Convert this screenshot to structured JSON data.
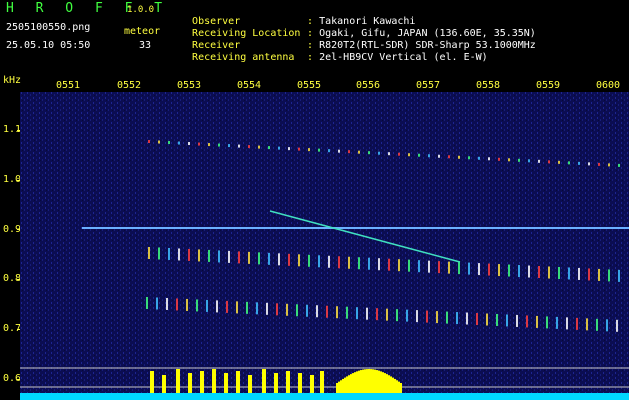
{
  "header": {
    "app_name": "H R O F F T",
    "version": "1.0.0",
    "filename": "2505100550.png",
    "meteor_label": "meteor",
    "datetime": "25.05.10 05:50",
    "meteor_count": "33"
  },
  "info": [
    {
      "label": "Observer",
      "value": "Takanori Kawachi"
    },
    {
      "label": "Receiving Location",
      "value": "Ogaki, Gifu, JAPAN (136.60E, 35.35N)"
    },
    {
      "label": "Receiver",
      "value": "R820T2(RTL-SDR) SDR-Sharp 53.1000MHz"
    },
    {
      "label": "Receiving antenna",
      "value": "2el-HB9CV Vertical (el. E-W)"
    }
  ],
  "axis": {
    "y_unit": "kHz",
    "time_ticks": [
      "0551",
      "0552",
      "0553",
      "0554",
      "0555",
      "0556",
      "0557",
      "0558",
      "0559",
      "0600"
    ],
    "freq_ticks": [
      "1.1",
      "1.0",
      "0.9",
      "0.8",
      "0.7",
      "0.6"
    ]
  },
  "colors": {
    "background": "#000000",
    "label_yellow": "#ffff40",
    "title_green": "#40ff40",
    "carrier_line": "#6ab0ff",
    "noise_floor": "#00d8ff",
    "burst_yellow": "#ffff00"
  }
}
